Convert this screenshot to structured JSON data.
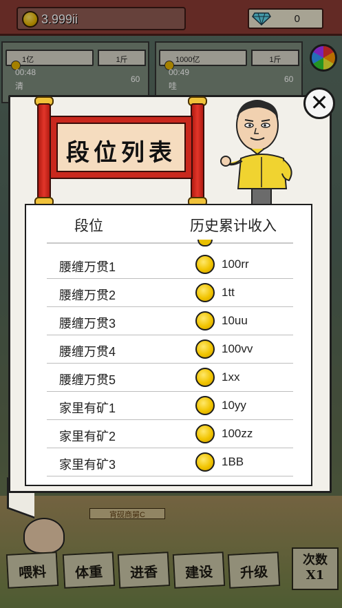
{
  "hud": {
    "coins": "3.999ii",
    "gems": "0"
  },
  "shops": [
    {
      "price": "1亿",
      "unit": "1斤",
      "timer": "00:48",
      "count": "60",
      "name": "清"
    },
    {
      "price": "1000亿",
      "unit": "1斤",
      "timer": "00:49",
      "count": "60",
      "name": "哇"
    }
  ],
  "modal": {
    "title": "段位列表",
    "close_label": "✕",
    "columns": {
      "rank": "段位",
      "income": "历史累计收入"
    },
    "rows": [
      {
        "rank": "腰缠万贯1",
        "income": "100rr"
      },
      {
        "rank": "腰缠万贯2",
        "income": "1tt"
      },
      {
        "rank": "腰缠万贯3",
        "income": "10uu"
      },
      {
        "rank": "腰缠万贯4",
        "income": "100vv"
      },
      {
        "rank": "腰缠万贯5",
        "income": "1xx"
      },
      {
        "rank": "家里有矿1",
        "income": "10yy"
      },
      {
        "rank": "家里有矿2",
        "income": "100zz"
      },
      {
        "rank": "家里有矿3",
        "income": "1BB"
      }
    ]
  },
  "background": {
    "sign_text": "宵砚商舅C"
  },
  "actions": {
    "feed": "喂料",
    "weight": "体重",
    "incense": "进香",
    "build": "建设",
    "upgrade": "升级",
    "times_line1": "次数",
    "times_line2": "X1"
  },
  "colors": {
    "accent_red": "#c9281d",
    "coin_gold": "#f1c400",
    "panel_bg": "#f2f0ea"
  }
}
